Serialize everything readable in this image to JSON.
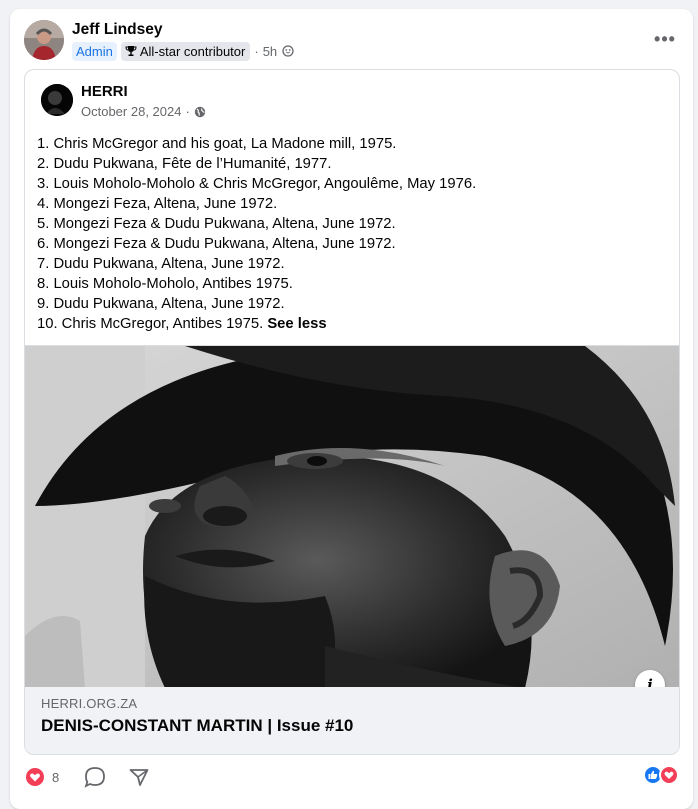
{
  "post": {
    "author": "Jeff Lindsey",
    "badge_admin": "Admin",
    "badge_allstar": "All-star contributor",
    "separator": "·",
    "time": "5h",
    "more_label": "•••"
  },
  "shared": {
    "page_name": "HERRI",
    "date": "October 28, 2024",
    "caption_lines": [
      "1. Chris McGregor and his goat, La Madone mill, 1975.",
      "2. Dudu Pukwana, Fête de l’Humanité, 1977.",
      "3. Louis Moholo-Moholo & Chris McGregor, Angoulême, May 1976.",
      "4. Mongezi Feza, Altena, June 1972.",
      "5. Mongezi Feza & Dudu Pukwana, Altena, June 1972.",
      "6. Mongezi Feza & Dudu Pukwana, Altena, June 1972.",
      "7. Dudu Pukwana, Altena, June 1972.",
      "8. Louis Moholo-Moholo, Antibes 1975.",
      "9. Dudu Pukwana, Altena, June 1972."
    ],
    "last_line": "10. Chris McGregor, Antibes 1975.",
    "see_less": "See less",
    "info_label": "i",
    "link_domain": "HERRI.ORG.ZA",
    "link_title": "DENIS-CONSTANT MARTIN | Issue #10"
  },
  "footer": {
    "reaction_count": "8"
  },
  "colors": {
    "accent": "#1b74e4",
    "love": "#f33e58",
    "like": "#1877f2",
    "muted": "#65676b"
  }
}
